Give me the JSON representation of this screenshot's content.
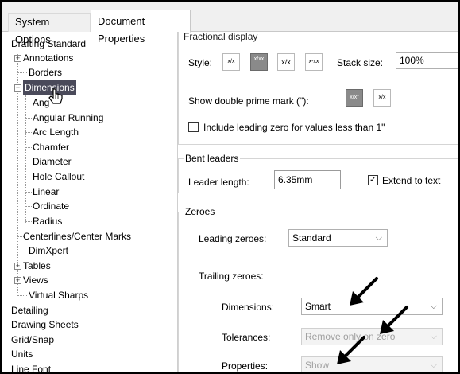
{
  "tabs": {
    "system_options": "System Options",
    "document_properties": "Document Properties"
  },
  "tree": {
    "items": [
      "Drafting Standard",
      "Annotations",
      "Borders",
      "Dimensions",
      "Angle",
      "Angular Running",
      "Arc Length",
      "Chamfer",
      "Diameter",
      "Hole Callout",
      "Linear",
      "Ordinate",
      "Radius",
      "Centerlines/Center Marks",
      "DimXpert",
      "Tables",
      "Views",
      "Virtual Sharps",
      "Detailing",
      "Drawing Sheets",
      "Grid/Snap",
      "Units",
      "Line Font"
    ],
    "angle_visible_text": "Ang"
  },
  "fractional": {
    "title": "Fractional display",
    "style_label": "Style:",
    "style_buttons": [
      "x/x",
      "x/xx",
      "x/x",
      "x-xx"
    ],
    "stack_size_label": "Stack size:",
    "stack_size_value": "100%",
    "double_prime_label": "Show double prime mark (\"):",
    "double_prime_buttons": [
      "x/x\"",
      "x/x"
    ],
    "leading_zero_label": "Include leading zero for values less than 1\""
  },
  "bent_leaders": {
    "title": "Bent leaders",
    "leader_length_label": "Leader length:",
    "leader_length_value": "6.35mm",
    "extend_to_text_label": "Extend to text"
  },
  "zeroes": {
    "title": "Zeroes",
    "leading_label": "Leading zeroes:",
    "leading_value": "Standard",
    "trailing_label": "Trailing zeroes:",
    "dimensions_label": "Dimensions:",
    "dimensions_value": "Smart",
    "tolerances_label": "Tolerances:",
    "tolerances_value": "Remove only on zero",
    "properties_label": "Properties:",
    "properties_value": "Show"
  }
}
